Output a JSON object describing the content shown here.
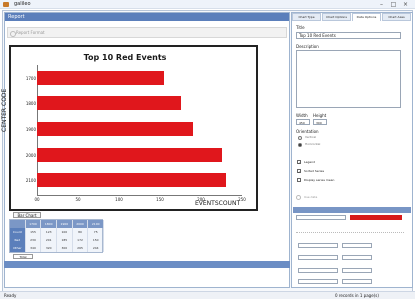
{
  "window": {
    "title": "galileo"
  },
  "left_panel": {
    "header": "Report",
    "subheader": "Report Format",
    "tab_button": "Bar Chart",
    "grid": {
      "headers": [
        "",
        "1700",
        "1800",
        "1900",
        "2000",
        "2100"
      ],
      "rows": [
        {
          "label": "Count",
          "cells": [
            "155",
            "123",
            "100",
            "80",
            "75"
          ]
        },
        {
          "label": "Red",
          "cells": [
            "230",
            "201",
            "185",
            "172",
            "150"
          ]
        },
        {
          "label": "Other Events",
          "cells": [
            "340",
            "320",
            "300",
            "265",
            "244"
          ]
        }
      ],
      "footer": "Total"
    }
  },
  "chart_data": {
    "type": "bar",
    "orientation": "horizontal",
    "title": "Top 10 Red Events",
    "xlabel": "EVENTSCOUNT",
    "ylabel": "CENTER CODE",
    "categories": [
      "1700",
      "1800",
      "1900",
      "2000",
      "2100"
    ],
    "values": [
      155,
      175,
      190,
      225,
      230
    ],
    "xlim": [
      0,
      250
    ],
    "xticks": [
      "00",
      "50",
      "100",
      "150",
      "200",
      "250"
    ],
    "color": "#e0171c"
  },
  "right_panel": {
    "tabs": [
      "Chart Type",
      "Chart Options",
      "Data Options",
      "Chart Axes"
    ],
    "title_label": "Title",
    "title_value": "Top 10 Red Events",
    "description_label": "Description",
    "width_label": "Width",
    "height_label": "Height",
    "width_value": "450",
    "height_value": "300",
    "orientation_label": "Orientation",
    "orientation_options": [
      "Vertical",
      "Horizontal"
    ],
    "checks": [
      "Legend",
      "Sorted Series",
      "Display series mean"
    ],
    "check_states": [
      true,
      true,
      false
    ],
    "apply": "Use data"
  },
  "status": {
    "left": "Ready",
    "right": "0 records in 1 page(s)"
  }
}
